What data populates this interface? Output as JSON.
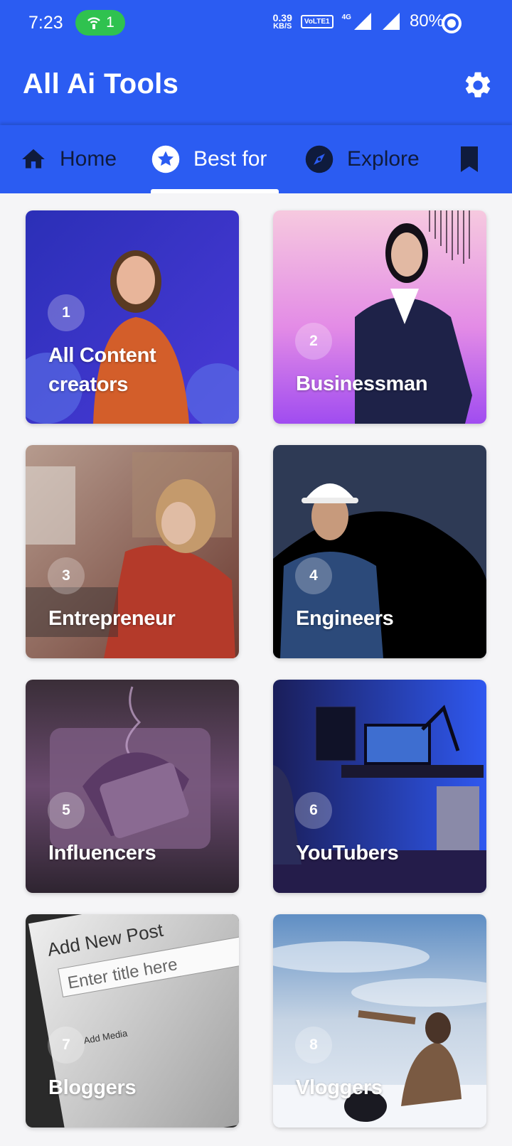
{
  "status_bar": {
    "time": "7:23",
    "hotspot_count": "1",
    "net_speed_value": "0.39",
    "net_speed_unit": "KB/S",
    "volte": "VoLTE1",
    "network": "4G",
    "battery": "80%"
  },
  "app_bar": {
    "title": "All Ai Tools"
  },
  "tabs": [
    {
      "label": "Home",
      "icon": "home-icon"
    },
    {
      "label": "Best for",
      "icon": "star-icon"
    },
    {
      "label": "Explore",
      "icon": "compass-icon"
    },
    {
      "label": "",
      "icon": "bookmark-icon"
    }
  ],
  "categories": [
    {
      "number": "1",
      "title": "All Content creators"
    },
    {
      "number": "2",
      "title": "Businessman"
    },
    {
      "number": "3",
      "title": "Entrepreneur"
    },
    {
      "number": "4",
      "title": "Engineers"
    },
    {
      "number": "5",
      "title": "Influencers"
    },
    {
      "number": "6",
      "title": "YouTubers"
    },
    {
      "number": "7",
      "title": "Bloggers"
    },
    {
      "number": "8",
      "title": "Vloggers"
    }
  ],
  "colors": {
    "primary": "#2b5cf2",
    "tab_text": "#0f1b3d",
    "active_tab_text": "#ffffff",
    "hotspot": "#2fc24f"
  }
}
